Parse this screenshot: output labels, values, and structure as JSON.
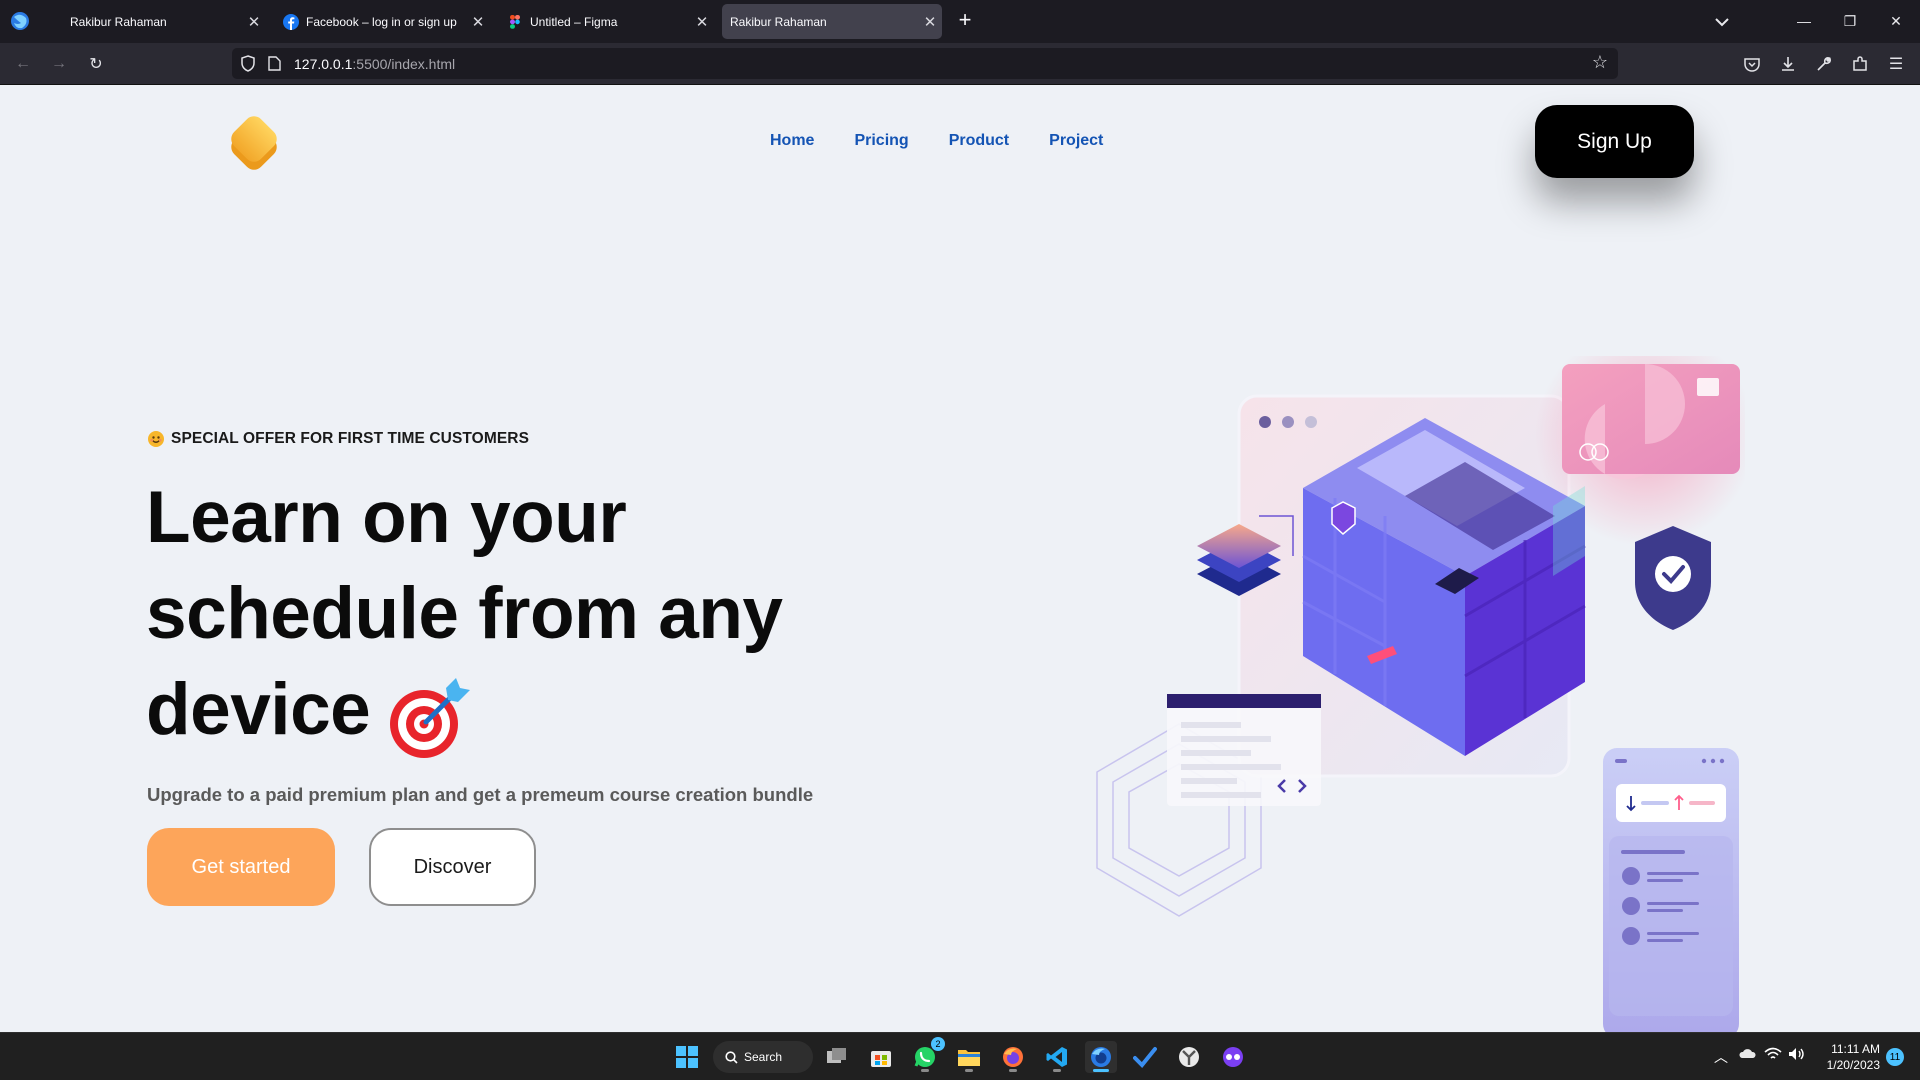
{
  "browser": {
    "tabs": [
      {
        "title": "Rakibur Rahaman",
        "favicon": "firefox-icon",
        "active": false
      },
      {
        "title": "Facebook – log in or sign up",
        "favicon": "facebook-icon",
        "active": false
      },
      {
        "title": "Untitled – Figma",
        "favicon": "figma-icon",
        "active": false
      },
      {
        "title": "Rakibur Rahaman",
        "favicon": "none",
        "active": true
      }
    ],
    "url_host": "127.0.0.1",
    "url_rest": ":5500/index.html"
  },
  "site": {
    "nav": [
      "Home",
      "Pricing",
      "Product",
      "Project"
    ],
    "signup_label": "Sign Up",
    "brand_color": "#f6b23a",
    "link_color": "#1454b4"
  },
  "hero": {
    "offer": "SPECIAL OFFER FOR FIRST TIME CUSTOMERS",
    "title_line1": "Learn on your",
    "title_line2": "schedule from any",
    "title_line3": "device",
    "subtitle": "Upgrade to a paid premium plan and get a premeum course creation bundle",
    "primary_label": "Get started",
    "secondary_label": "Discover",
    "primary_color": "#fda55a"
  },
  "taskbar": {
    "search_label": "Search",
    "whatsapp_badge": "2",
    "time": "11:11 AM",
    "date": "1/20/2023",
    "notifications": "11"
  }
}
